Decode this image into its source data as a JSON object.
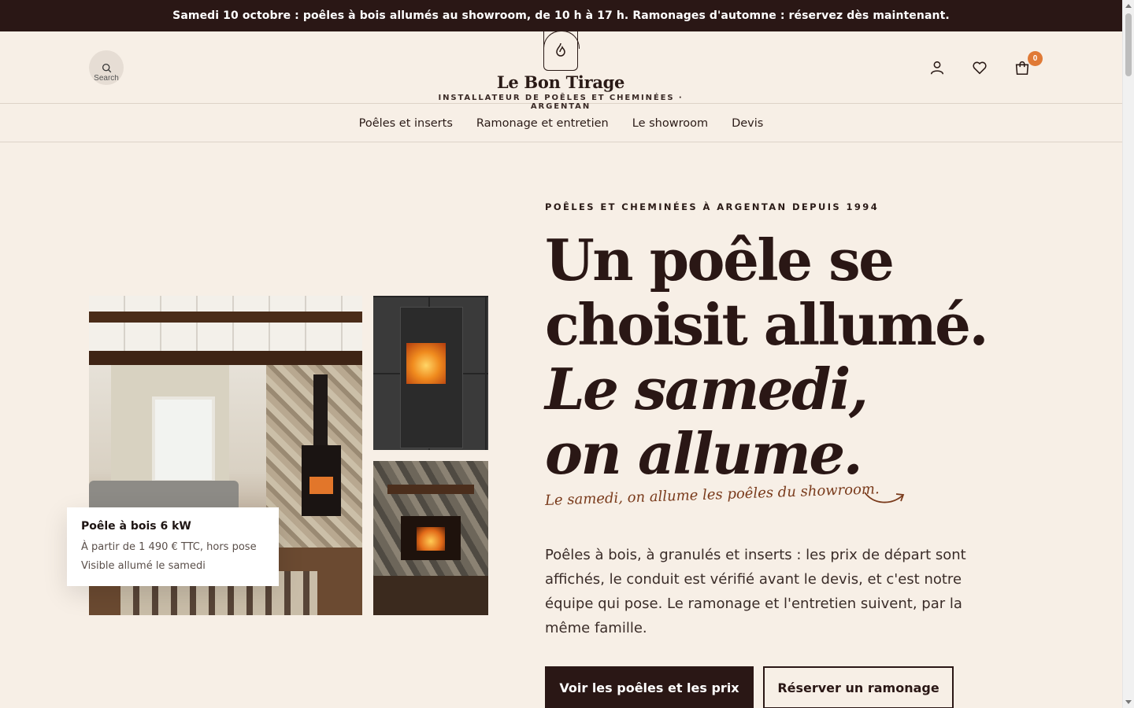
{
  "announcement": "Samedi 10 octobre : poêles à bois allumés au showroom, de 10 h à 17 h. Ramonages d'automne : réservez dès maintenant.",
  "header": {
    "search_label": "Search",
    "brand_name": "Le Bon Tirage",
    "brand_tagline": "INSTALLATEUR DE POÊLES ET CHEMINÉES · ARGENTAN",
    "cart_count": "0",
    "icons": [
      "search-icon",
      "flame-icon",
      "account-icon",
      "heart-icon",
      "cart-icon"
    ]
  },
  "nav": {
    "items": [
      {
        "label": "Poêles et inserts"
      },
      {
        "label": "Ramonage et entretien"
      },
      {
        "label": "Le showroom"
      },
      {
        "label": "Devis"
      }
    ]
  },
  "product_card": {
    "title": "Poêle à bois 6 kW",
    "price": "À partir de 1 490 € TTC, hors pose",
    "note": "Visible allumé le samedi"
  },
  "hero": {
    "eyebrow": "POÊLES ET CHEMINÉES À ARGENTAN DEPUIS 1994",
    "headline_line1": "Un poêle se",
    "headline_line2": "choisit allumé.",
    "headline_italic1": "Le samedi,",
    "headline_italic2": "on allume.",
    "script_note": "Le samedi, on allume les poêles du showroom.",
    "lead": "Poêles à bois, à granulés et inserts : les prix de départ sont affichés, le conduit est vérifié avant le devis, et c'est notre équipe qui pose. Le ramonage et l'entretien suivent, par la même famille.",
    "cta_primary": "Voir les poêles et les prix",
    "cta_secondary": "Réserver un ramonage"
  },
  "colors": {
    "background": "#f7efe6",
    "dark": "#2a1715",
    "accent": "#e07a36",
    "script": "#7a3b1c"
  }
}
